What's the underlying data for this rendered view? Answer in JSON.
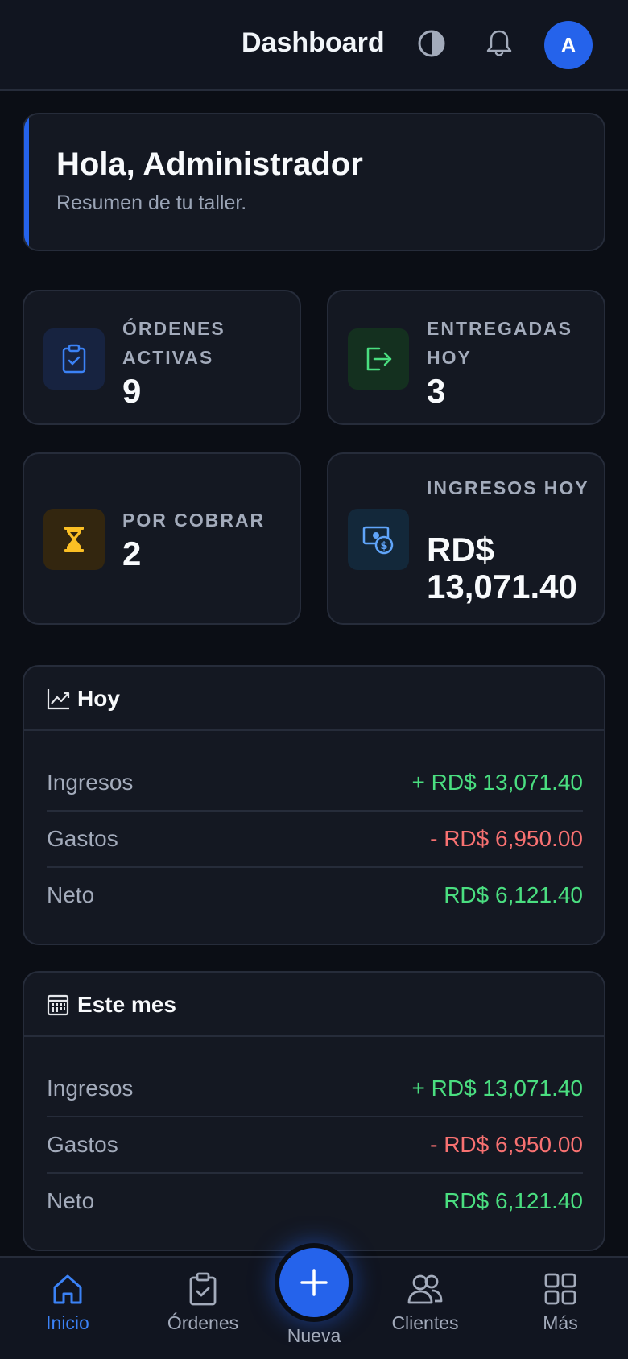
{
  "header": {
    "title": "Dashboard",
    "avatar_initial": "A"
  },
  "welcome": {
    "title": "Hola, Administrador",
    "subtitle": "Resumen de tu taller."
  },
  "stats": [
    {
      "label": "ÓRDENES ACTIVAS",
      "value": "9",
      "icon": "clipboard-check-icon",
      "color": "#3b82f6"
    },
    {
      "label": "ENTREGADAS HOY",
      "value": "3",
      "icon": "exit-arrow-icon",
      "color": "#4ade80"
    },
    {
      "label": "POR COBRAR",
      "value": "2",
      "icon": "hourglass-icon",
      "color": "#fbbf24"
    },
    {
      "label": "INGRESOS HOY",
      "value": "RD$ 13,071.40",
      "icon": "money-icon",
      "color": "#60a5fa"
    }
  ],
  "today": {
    "title": "Hoy",
    "rows": [
      {
        "label": "Ingresos",
        "value": "+ RD$ 13,071.40"
      },
      {
        "label": "Gastos",
        "value": "- RD$ 6,950.00"
      },
      {
        "label": "Neto",
        "value": "RD$ 6,121.40"
      }
    ]
  },
  "month": {
    "title": "Este mes",
    "rows": [
      {
        "label": "Ingresos",
        "value": "+ RD$ 13,071.40"
      },
      {
        "label": "Gastos",
        "value": "- RD$ 6,950.00"
      },
      {
        "label": "Neto",
        "value": "RD$ 6,121.40"
      }
    ]
  },
  "nav": {
    "items": [
      {
        "label": "Inicio",
        "icon": "home-icon"
      },
      {
        "label": "Órdenes",
        "icon": "clipboard-icon"
      },
      {
        "label": "Nueva",
        "icon": "plus-icon"
      },
      {
        "label": "Clientes",
        "icon": "users-icon"
      },
      {
        "label": "Más",
        "icon": "grid-icon"
      }
    ]
  },
  "colors": {
    "accent": "#2563eb",
    "positive": "#4ade80",
    "negative": "#f87171"
  }
}
